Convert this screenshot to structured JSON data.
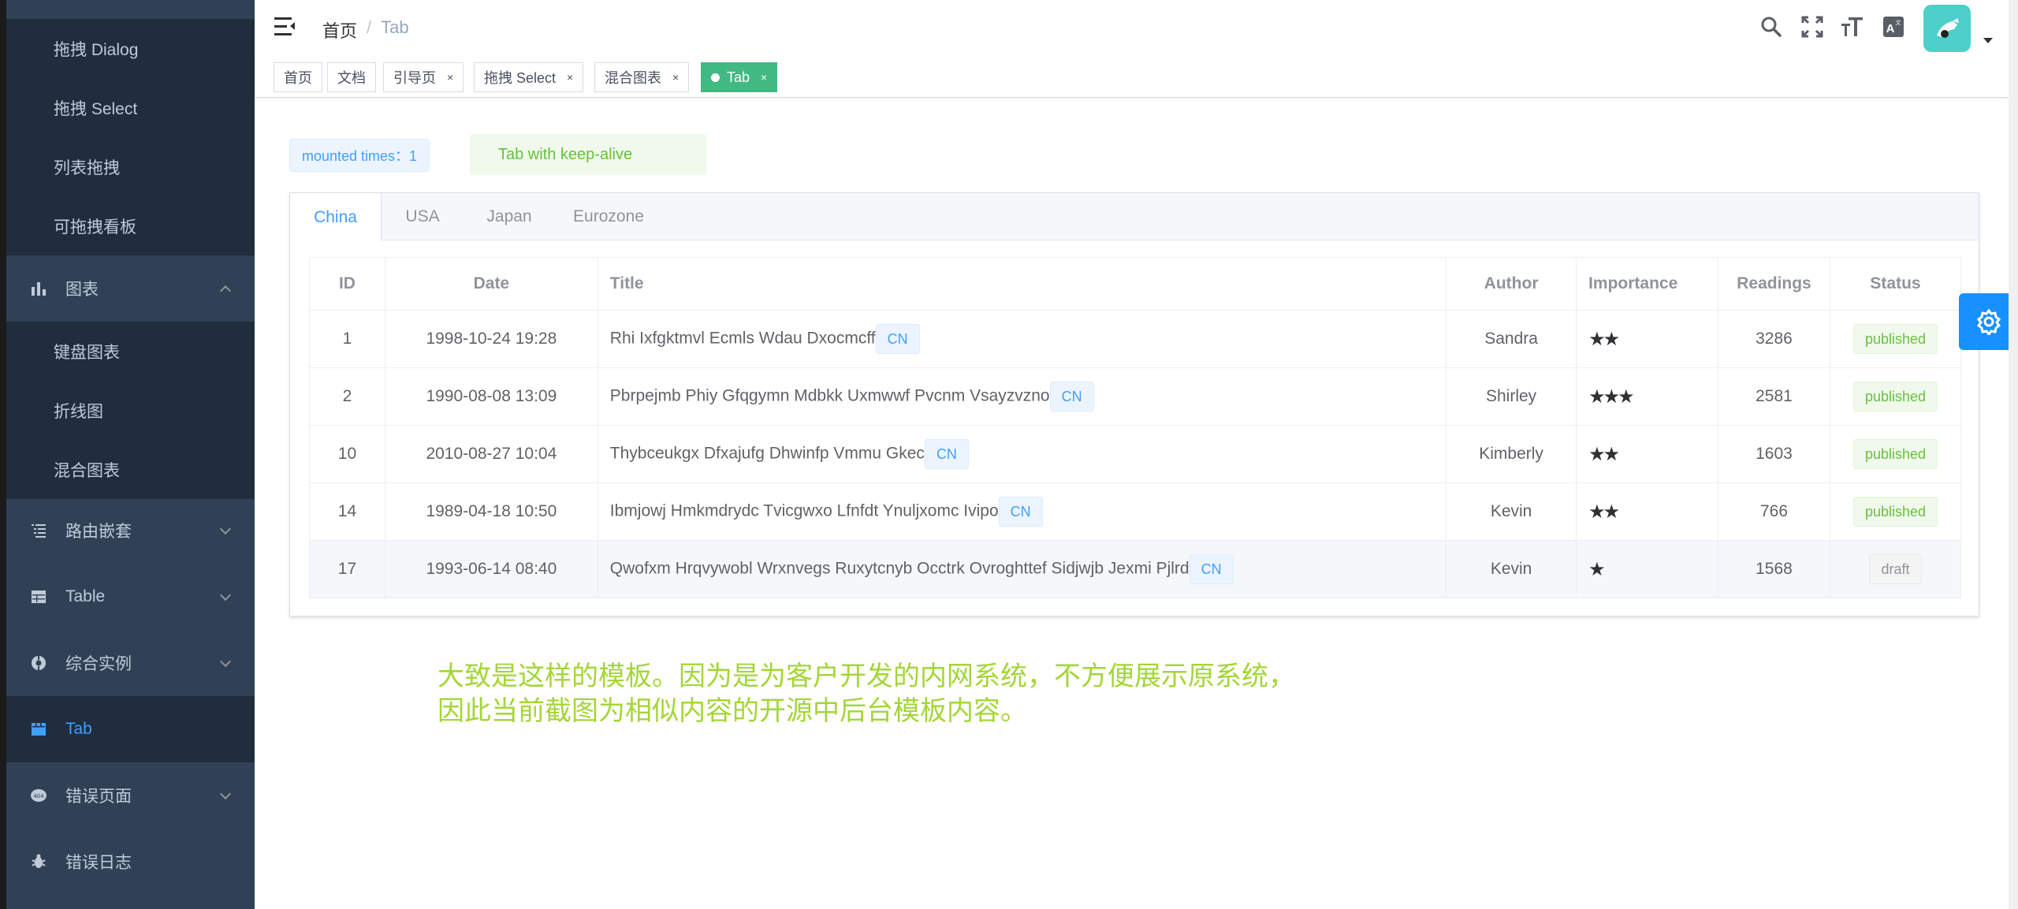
{
  "sidebar": {
    "sub_items_top": [
      "拖拽 Dialog",
      "拖拽 Select",
      "列表拖拽",
      "可拖拽看板"
    ],
    "charts": {
      "label": "图表",
      "icon": "bar-chart-icon"
    },
    "chart_items": [
      "键盘图表",
      "折线图",
      "混合图表"
    ],
    "nested": {
      "label": "路由嵌套",
      "icon": "list-icon"
    },
    "table": {
      "label": "Table",
      "icon": "table-icon"
    },
    "examples": {
      "label": "综合实例",
      "icon": "example-icon"
    },
    "tab": {
      "label": "Tab",
      "icon": "tab-icon"
    },
    "error_pages": {
      "label": "错误页面",
      "icon": "404-icon"
    },
    "error_log": {
      "label": "错误日志",
      "icon": "bug-icon"
    }
  },
  "navbar": {
    "breadcrumb": [
      "首页",
      "/",
      "Tab"
    ]
  },
  "tags": [
    {
      "label": "首页",
      "closable": false
    },
    {
      "label": "文档",
      "closable": false
    },
    {
      "label": "引导页",
      "closable": true
    },
    {
      "label": "拖拽 Select",
      "closable": true
    },
    {
      "label": "混合图表",
      "closable": true
    },
    {
      "label": "Tab",
      "closable": true,
      "active": true
    }
  ],
  "close_glyph": "×",
  "mounted": "mounted times：1",
  "keepalive": "Tab with keep-alive",
  "tabs": [
    "China",
    "USA",
    "Japan",
    "Eurozone"
  ],
  "table": {
    "headers": [
      "ID",
      "Date",
      "Title",
      "Author",
      "Importance",
      "Readings",
      "Status"
    ],
    "rows": [
      {
        "id": "1",
        "date": "1998-10-24 19:28",
        "title": "Rhi Ixfgktmvl Ecmls Wdau Dxocmcff",
        "tag": "CN",
        "author": "Sandra",
        "importance": 2,
        "stars": "★★",
        "readings": "3286",
        "status": "published"
      },
      {
        "id": "2",
        "date": "1990-08-08 13:09",
        "title": "Pbrpejmb Phiy Gfqgymn Mdbkk Uxmwwf Pvcnm Vsayzvzno",
        "tag": "CN",
        "author": "Shirley",
        "importance": 3,
        "stars": "★★★",
        "readings": "2581",
        "status": "published"
      },
      {
        "id": "10",
        "date": "2010-08-27 10:04",
        "title": "Thybceukgx Dfxajufg Dhwinfp Vmmu Gkec",
        "tag": "CN",
        "author": "Kimberly",
        "importance": 2,
        "stars": "★★",
        "readings": "1603",
        "status": "published"
      },
      {
        "id": "14",
        "date": "1989-04-18 10:50",
        "title": "Ibmjowj Hmkmdrydc Tvicgwxo Lfnfdt Ynuljxomc Ivipo",
        "tag": "CN",
        "author": "Kevin",
        "importance": 2,
        "stars": "★★",
        "readings": "766",
        "status": "published"
      },
      {
        "id": "17",
        "date": "1993-06-14 08:40",
        "title": "Qwofxm Hrqvywobl Wrxnvegs Ruxytcnyb Occtrk Ovroghttef Sidjwjb Jexmi Pjlrd",
        "tag": "CN",
        "author": "Kevin",
        "importance": 1,
        "stars": "★",
        "readings": "1568",
        "status": "draft"
      }
    ]
  },
  "note": {
    "line1": "大致是这样的模板。因为是为客户开发的内网系统，不方便展示原系统，",
    "line2": "因此当前截图为相似内容的开源中后台模板内容。"
  },
  "colors": {
    "sidebar_bg": "#304156",
    "active": "#409eff",
    "tag_active": "#42b983",
    "note": "#a4d636"
  }
}
